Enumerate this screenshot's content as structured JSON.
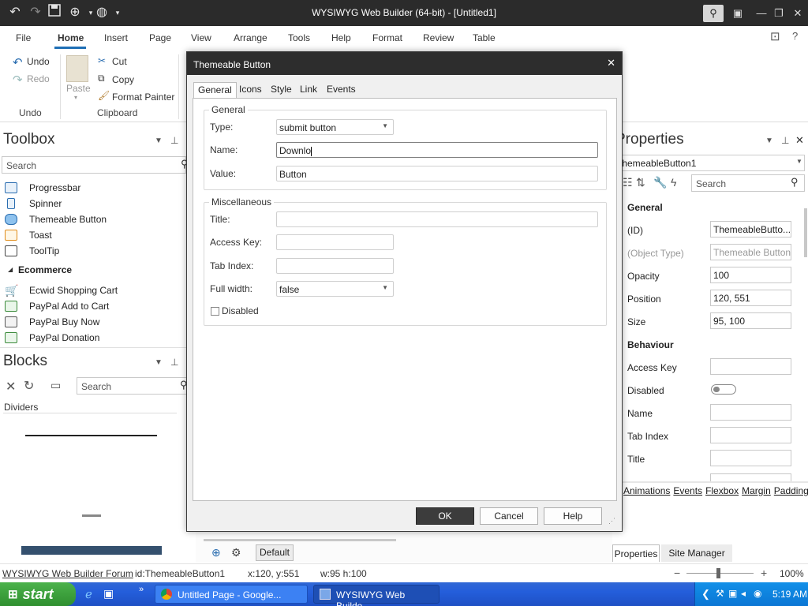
{
  "window": {
    "title": "WYSIWYG Web Builder (64-bit) - [Untitled1]"
  },
  "menu": {
    "tabs": [
      {
        "label": "File"
      },
      {
        "label": "Home"
      },
      {
        "label": "Insert"
      },
      {
        "label": "Page"
      },
      {
        "label": "View"
      },
      {
        "label": "Arrange"
      },
      {
        "label": "Tools"
      },
      {
        "label": "Help"
      },
      {
        "label": "Format"
      },
      {
        "label": "Review"
      },
      {
        "label": "Table"
      }
    ]
  },
  "ribbon": {
    "undo": "Undo",
    "redo": "Redo",
    "undo_group": "Undo",
    "paste": "Paste",
    "cut": "Cut",
    "copy": "Copy",
    "format_painter": "Format Painter",
    "clipboard_group": "Clipboard"
  },
  "toolbox": {
    "title": "Toolbox",
    "search_placeholder": "Search",
    "items": [
      {
        "label": "Progressbar"
      },
      {
        "label": "Spinner"
      },
      {
        "label": "Themeable Button"
      },
      {
        "label": "Toast"
      },
      {
        "label": "ToolTip"
      }
    ],
    "category": "Ecommerce",
    "ecommerce_items": [
      {
        "label": "Ecwid Shopping Cart"
      },
      {
        "label": "PayPal Add to Cart"
      },
      {
        "label": "PayPal Buy Now"
      },
      {
        "label": "PayPal Donation"
      }
    ]
  },
  "blocks": {
    "title": "Blocks",
    "search_placeholder": "Search",
    "category": "Dividers"
  },
  "properties": {
    "title": "Properties",
    "object": "ThemeableButton1",
    "search_placeholder": "Search",
    "section_general": "General",
    "section_behaviour": "Behaviour",
    "rows": [
      {
        "label": "(ID)",
        "value": "ThemeableButto..."
      },
      {
        "label": "(Object Type)",
        "value": "Themeable Button"
      },
      {
        "label": "Opacity",
        "value": "100"
      },
      {
        "label": "Position",
        "value": "120, 551"
      },
      {
        "label": "Size",
        "value": "95, 100"
      }
    ],
    "behaviour_rows": [
      {
        "label": "Access Key"
      },
      {
        "label": "Disabled"
      },
      {
        "label": "Name"
      },
      {
        "label": "Tab Index"
      },
      {
        "label": "Title"
      }
    ],
    "links": [
      "Animations",
      "Events",
      "Flexbox",
      "Margin",
      "Padding"
    ],
    "tab_properties": "Properties",
    "tab_site_manager": "Site Manager"
  },
  "dialog": {
    "title": "Themeable Button",
    "tabs": [
      {
        "label": "General"
      },
      {
        "label": "Icons"
      },
      {
        "label": "Style"
      },
      {
        "label": "Link"
      },
      {
        "label": "Events"
      }
    ],
    "general_group": "General",
    "type_label": "Type:",
    "type_value": "submit button",
    "name_label": "Name:",
    "name_value": "Downlo",
    "value_label": "Value:",
    "value_value": "Button",
    "misc_group": "Miscellaneous",
    "title_label": "Title:",
    "access_key_label": "Access Key:",
    "tab_index_label": "Tab Index:",
    "full_width_label": "Full width:",
    "full_width_value": "false",
    "disabled_label": "Disabled",
    "ok": "OK",
    "cancel": "Cancel",
    "help": "Help"
  },
  "editor": {
    "default_tab": "Default"
  },
  "statusbar": {
    "forum_link": "WYSIWYG Web Builder Forum",
    "id": "id:ThemeableButton1",
    "xy": "x:120, y:551",
    "wh": "w:95 h:100",
    "zoom": "100%"
  },
  "taskbar": {
    "start": "start",
    "tasks": [
      {
        "label": "Untitled Page - Google..."
      },
      {
        "label": "WYSIWYG Web Builde..."
      }
    ],
    "clock": "5:19 AM"
  }
}
